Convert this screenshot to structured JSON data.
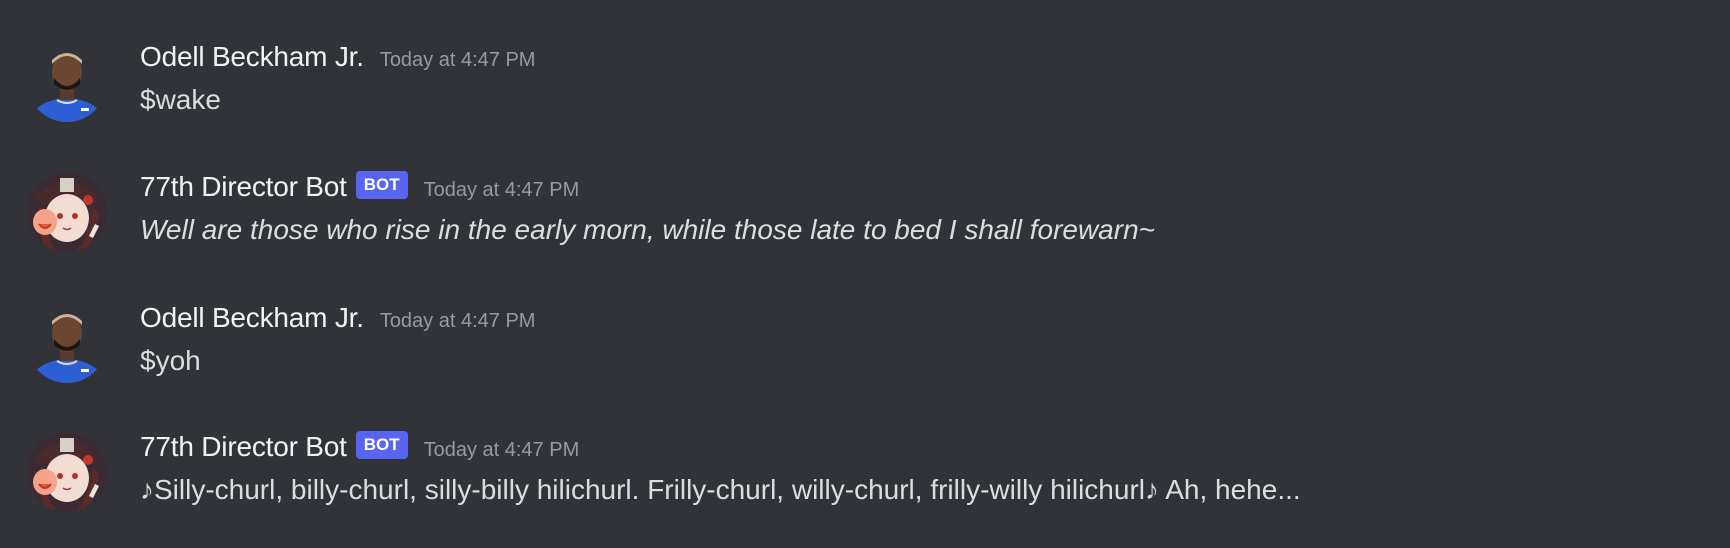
{
  "messages": [
    {
      "author": "Odell Beckham Jr.",
      "is_bot": false,
      "timestamp": "Today at 4:47 PM",
      "content": "$wake",
      "italic": false,
      "avatar_icon": "player-avatar-icon"
    },
    {
      "author": "77th Director Bot",
      "is_bot": true,
      "bot_tag": "BOT",
      "timestamp": "Today at 4:47 PM",
      "content": "Well are those who rise in the early morn, while those late to bed I shall forewarn~",
      "italic": true,
      "avatar_icon": "anime-character-avatar-icon"
    },
    {
      "author": "Odell Beckham Jr.",
      "is_bot": false,
      "timestamp": "Today at 4:47 PM",
      "content": "$yoh",
      "italic": false,
      "avatar_icon": "player-avatar-icon"
    },
    {
      "author": "77th Director Bot",
      "is_bot": true,
      "bot_tag": "BOT",
      "timestamp": "Today at 4:47 PM",
      "content": "♪Silly-churl, billy-churl, silly-billy hilichurl. Frilly-churl, willy-churl, frilly-willy hilichurl♪ Ah, hehe...",
      "italic": false,
      "avatar_icon": "anime-character-avatar-icon"
    }
  ],
  "colors": {
    "background": "#313338",
    "username": "#f2f3f5",
    "timestamp": "#949ba4",
    "content": "#dbdee1",
    "bot_tag_bg": "#5865f2"
  }
}
